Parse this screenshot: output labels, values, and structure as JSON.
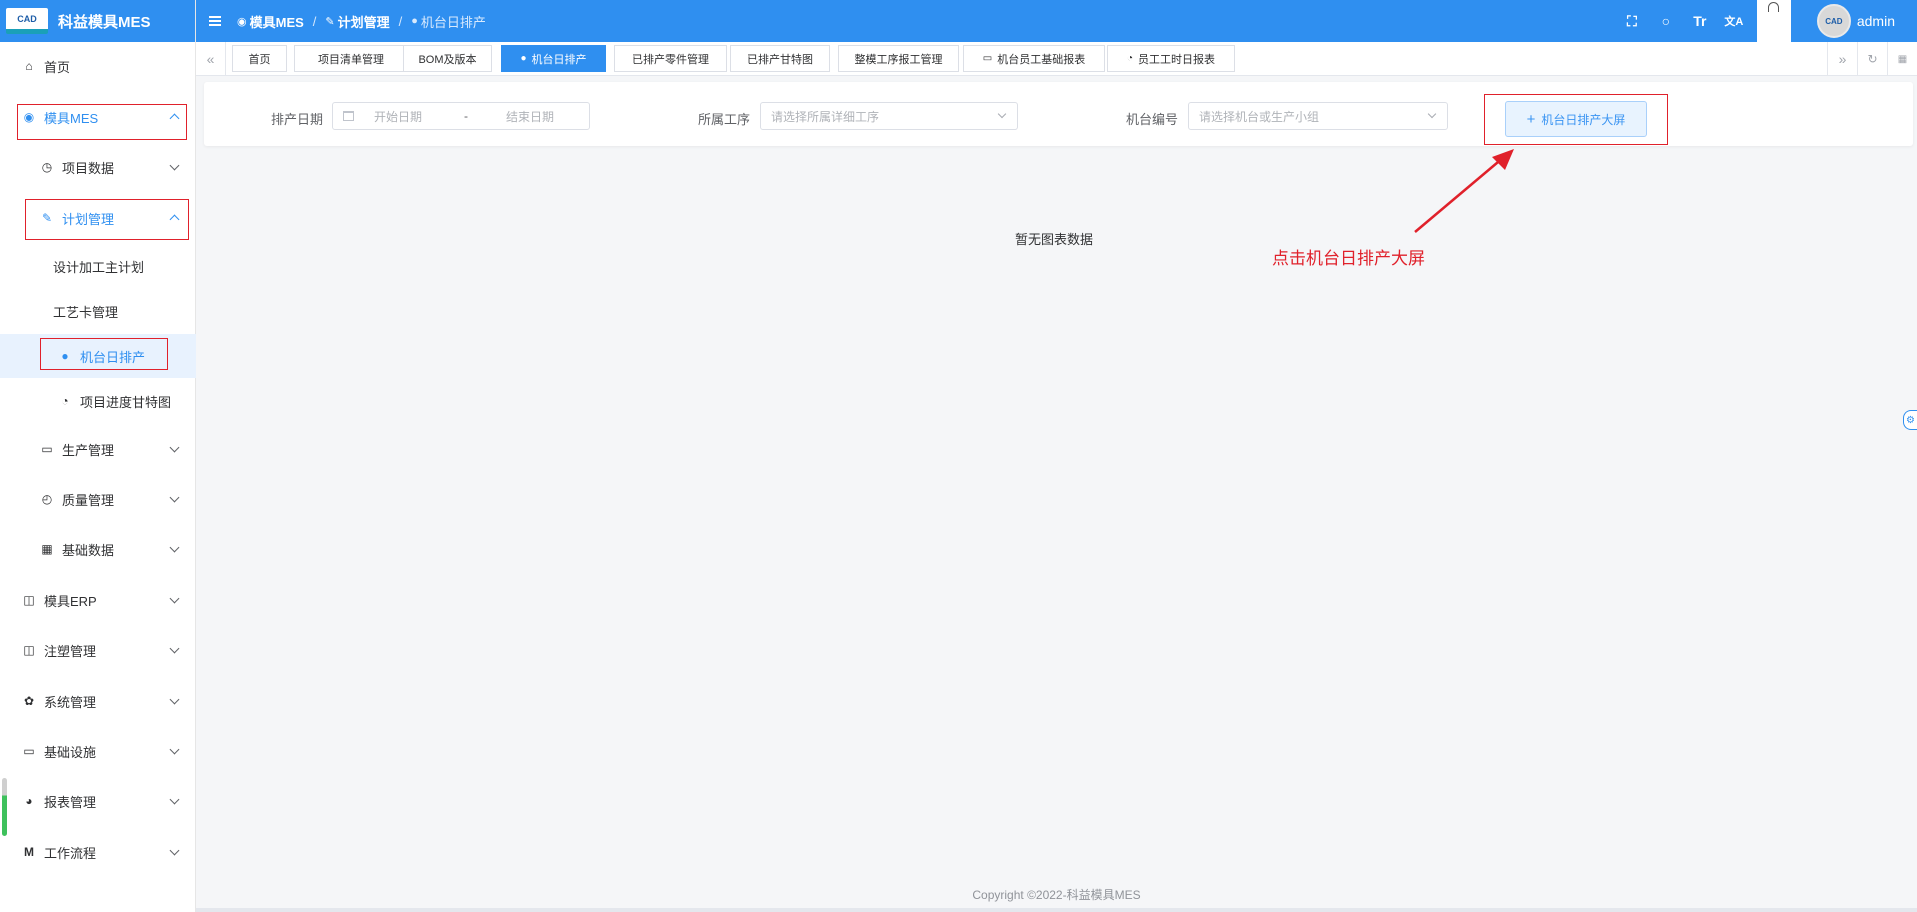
{
  "app": {
    "logo_text": "CAD",
    "title": "科益模具MES"
  },
  "sidebar": {
    "home": "首页",
    "mes": "模具MES",
    "project_data": "项目数据",
    "plan_mgmt": "计划管理",
    "design_plan": "设计加工主计划",
    "process_card": "工艺卡管理",
    "machine_daily": "机台日排产",
    "gantt": "项目进度甘特图",
    "production": "生产管理",
    "quality": "质量管理",
    "basic_data": "基础数据",
    "erp": "模具ERP",
    "injection": "注塑管理",
    "system": "系统管理",
    "infrastructure": "基础设施",
    "reports": "报表管理",
    "workflow": "工作流程"
  },
  "header": {
    "crumbs": [
      "模具MES",
      "计划管理",
      "机台日排产"
    ],
    "separator": "/",
    "font_icon": "Tr",
    "translate_icon": "文A",
    "avatar_text": "CAD",
    "user": "admin"
  },
  "tags": [
    "首页",
    "项目清单管理",
    "BOM及版本",
    "机台日排产",
    "已排产零件管理",
    "已排产甘特图",
    "整模工序报工管理",
    "机台员工基础报表",
    "员工工时日报表"
  ],
  "filters": {
    "date_label": "排产日期",
    "start_placeholder": "开始日期",
    "range_sep": "-",
    "end_placeholder": "结束日期",
    "process_label": "所属工序",
    "process_placeholder": "请选择所属详细工序",
    "machine_label": "机台编号",
    "machine_placeholder": "请选择机台或生产小组",
    "screen_button": "机台日排产大屏"
  },
  "main": {
    "empty_text": "暂无图表数据",
    "annotation": "点击机台日排产大屏",
    "copyright": "Copyright ©2022-科益模具MES"
  },
  "colors": {
    "primary": "#2f8ff0",
    "annotation": "#e0212b"
  }
}
